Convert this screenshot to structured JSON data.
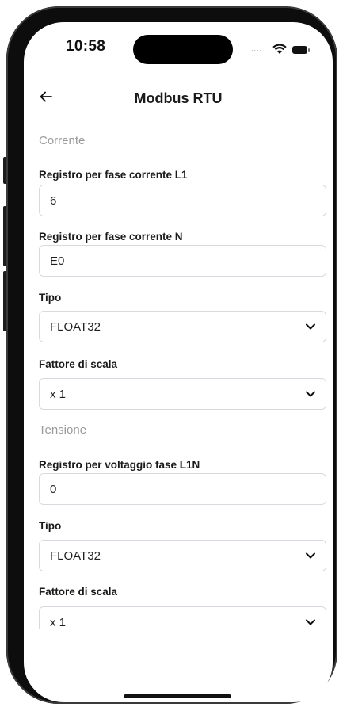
{
  "status_bar": {
    "time": "10:58",
    "signal_dots": "....",
    "icons": [
      "wifi-icon",
      "battery-icon"
    ]
  },
  "header": {
    "back_icon": "arrow-left-icon",
    "title": "Modbus RTU"
  },
  "form": {
    "corrente": {
      "section_title": "Corrente",
      "registro_l1": {
        "label": "Registro per fase corrente L1",
        "value": "6"
      },
      "registro_n": {
        "label": "Registro per fase corrente N",
        "value": "E0"
      },
      "tipo": {
        "label": "Tipo",
        "value": "FLOAT32"
      },
      "fattore": {
        "label": "Fattore di scala",
        "value": "x 1"
      }
    },
    "tensione": {
      "section_title": "Tensione",
      "registro_l1n": {
        "label": "Registro per voltaggio fase L1N",
        "value": "0"
      },
      "tipo": {
        "label": "Tipo",
        "value": "FLOAT32"
      },
      "fattore": {
        "label": "Fattore di scala",
        "value": "x 1"
      }
    }
  },
  "colors": {
    "text": "#1a1a1a",
    "muted": "#9a9a9a",
    "border": "#d7dade",
    "frame": "#0d0d0d"
  }
}
